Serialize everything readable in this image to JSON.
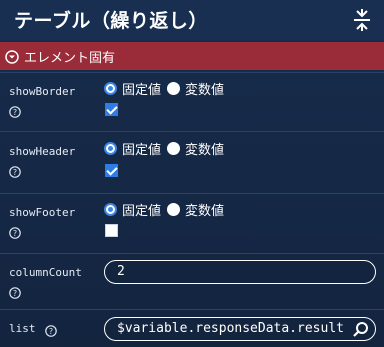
{
  "header": {
    "title": "テーブル（繰り返し）",
    "collapse_icon": "collapse-all-icon"
  },
  "section": {
    "label": "エレメント固有",
    "icon": "chevron-down-circle-icon",
    "color": "#9a2c3a"
  },
  "properties": [
    {
      "name": "showBorder",
      "radio_fixed": "固定値",
      "radio_variable": "変数値",
      "selected": "固定値",
      "checked": true
    },
    {
      "name": "showHeader",
      "radio_fixed": "固定値",
      "radio_variable": "変数値",
      "selected": "固定値",
      "checked": true
    },
    {
      "name": "showFooter",
      "radio_fixed": "固定値",
      "radio_variable": "変数値",
      "selected": "固定値",
      "checked": false
    },
    {
      "name": "columnCount",
      "value": "2"
    },
    {
      "name": "list",
      "value": "$variable.responseData.result"
    }
  ],
  "colors": {
    "background": "#142744",
    "accent": "#3b86e8"
  }
}
